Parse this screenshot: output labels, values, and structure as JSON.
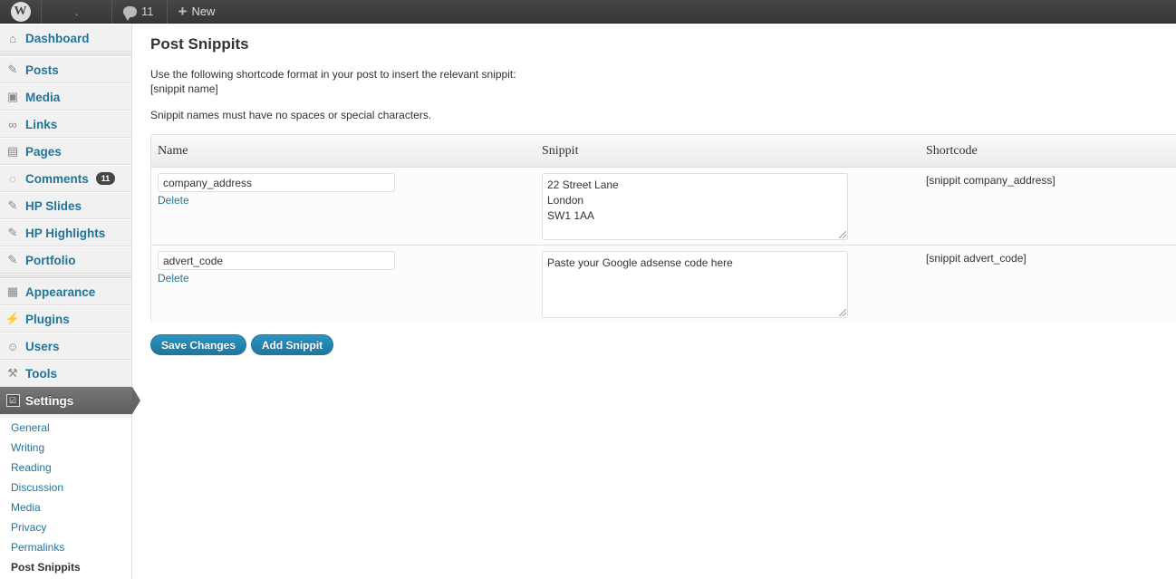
{
  "adminbar": {
    "site_name": ".",
    "comments_count": "11",
    "new_label": "New"
  },
  "sidebar": {
    "items": [
      {
        "label": "Dashboard",
        "icon": "home-icon"
      },
      {
        "label": "Posts",
        "icon": "pin-icon"
      },
      {
        "label": "Media",
        "icon": "media-icon"
      },
      {
        "label": "Links",
        "icon": "link-icon"
      },
      {
        "label": "Pages",
        "icon": "pages-icon"
      },
      {
        "label": "Comments",
        "icon": "comment-icon",
        "badge": "11"
      },
      {
        "label": "HP Slides",
        "icon": "pin-icon"
      },
      {
        "label": "HP Highlights",
        "icon": "pin-icon"
      },
      {
        "label": "Portfolio",
        "icon": "pin-icon"
      },
      {
        "label": "Appearance",
        "icon": "appearance-icon"
      },
      {
        "label": "Plugins",
        "icon": "plugin-icon"
      },
      {
        "label": "Users",
        "icon": "users-icon"
      },
      {
        "label": "Tools",
        "icon": "tools-icon"
      },
      {
        "label": "Settings",
        "icon": "settings-icon"
      }
    ],
    "submenu": [
      "General",
      "Writing",
      "Reading",
      "Discussion",
      "Media",
      "Privacy",
      "Permalinks",
      "Post Snippits"
    ]
  },
  "main": {
    "title": "Post Snippits",
    "intro_line1": "Use the following shortcode format in your post to insert the relevant snippit:",
    "intro_line2": "[snippit name]",
    "intro_line3": "Snippit names must have no spaces or special characters.",
    "table": {
      "headers": [
        "Name",
        "Snippit",
        "Shortcode"
      ],
      "rows": [
        {
          "name": "company_address",
          "delete": "Delete",
          "snippet": "22 Street Lane\nLondon\nSW1 1AA",
          "shortcode": "[snippit company_address]"
        },
        {
          "name": "advert_code",
          "delete": "Delete",
          "snippet": "Paste your Google adsense code here",
          "shortcode": "[snippit advert_code]"
        }
      ]
    },
    "save_label": "Save Changes",
    "add_label": "Add Snippit"
  },
  "colors": {
    "link": "#21759b",
    "adminbar": "#464646",
    "button": "#21759b"
  }
}
